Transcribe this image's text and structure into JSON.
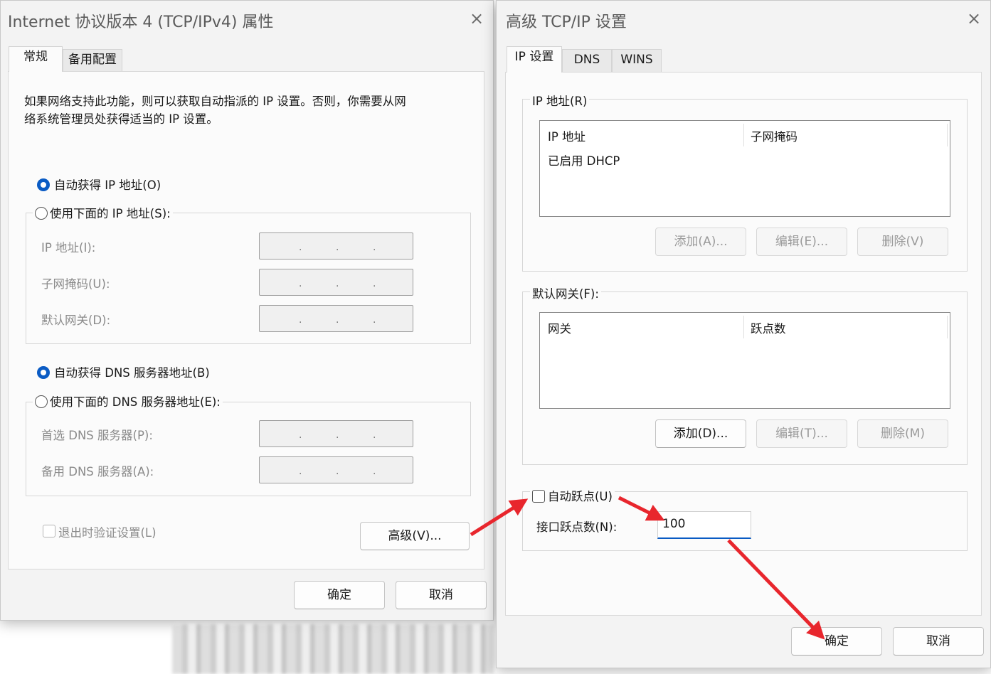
{
  "left_dialog": {
    "title": "Internet 协议版本 4 (TCP/IPv4) 属性",
    "close_glyph": "×",
    "tabs": [
      "常规",
      "备用配置"
    ],
    "description_line1": "如果网络支持此功能，则可以获取自动指派的 IP 设置。否则，你需要从网",
    "description_line2": "络系统管理员处获得适当的 IP 设置。",
    "radio_auto_ip": "自动获得 IP 地址(O)",
    "radio_manual_ip": "使用下面的 IP 地址(S):",
    "label_ip": "IP 地址(I):",
    "label_mask": "子网掩码(U):",
    "label_gateway": "默认网关(D):",
    "radio_auto_dns": "自动获得 DNS 服务器地址(B)",
    "radio_manual_dns": "使用下面的 DNS 服务器地址(E):",
    "label_pref_dns": "首选 DNS 服务器(P):",
    "label_alt_dns": "备用 DNS 服务器(A):",
    "ip_dot": ".",
    "validate_on_exit": "退出时验证设置(L)",
    "advanced_button": "高级(V)...",
    "ok_button": "确定",
    "cancel_button": "取消"
  },
  "right_dialog": {
    "title": "高级 TCP/IP 设置",
    "close_glyph": "×",
    "tabs": [
      "IP 设置",
      "DNS",
      "WINS"
    ],
    "ip_group_label": "IP 地址(R)",
    "ip_col_address": "IP 地址",
    "ip_col_mask": "子网掩码",
    "ip_row_1": "已启用 DHCP",
    "ip_add": "添加(A)...",
    "ip_edit": "编辑(E)...",
    "ip_delete": "删除(V)",
    "gw_group_label": "默认网关(F):",
    "gw_col_gateway": "网关",
    "gw_col_metric": "跃点数",
    "gw_add": "添加(D)...",
    "gw_edit": "编辑(T)...",
    "gw_delete": "删除(M)",
    "auto_metric": "自动跃点(U)",
    "interface_metric_label": "接口跃点数(N):",
    "interface_metric_value": "100",
    "ok_button": "确定",
    "cancel_button": "取消"
  },
  "colors": {
    "accent": "#0a5bc4",
    "annotation_arrow": "#e8262d"
  }
}
